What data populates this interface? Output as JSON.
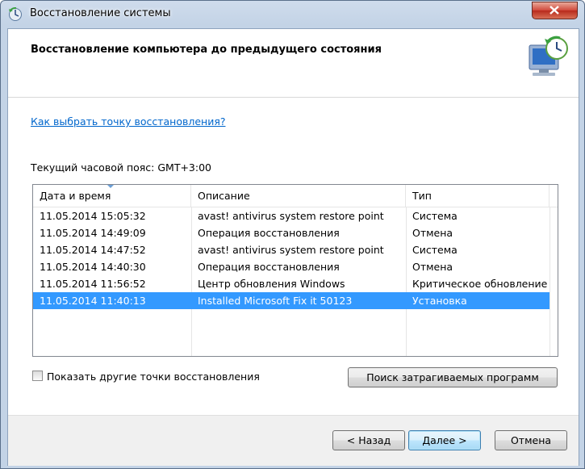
{
  "window": {
    "title": "Восстановление системы"
  },
  "header": {
    "title": "Восстановление компьютера до предыдущего состояния"
  },
  "help_link": "Как выбрать точку восстановления?",
  "timezone_label": "Текущий часовой пояс: GMT+3:00",
  "table": {
    "columns": [
      "Дата и время",
      "Описание",
      "Тип"
    ],
    "sorted_column": "Дата и время",
    "rows": [
      {
        "date": "11.05.2014 15:05:32",
        "description": "avast! antivirus system restore point",
        "type": "Система",
        "selected": false
      },
      {
        "date": "11.05.2014 14:49:09",
        "description": "Операция восстановления",
        "type": "Отмена",
        "selected": false
      },
      {
        "date": "11.05.2014 14:47:52",
        "description": "avast! antivirus system restore point",
        "type": "Система",
        "selected": false
      },
      {
        "date": "11.05.2014 14:40:30",
        "description": "Операция восстановления",
        "type": "Отмена",
        "selected": false
      },
      {
        "date": "11.05.2014 11:56:52",
        "description": "Центр обновления Windows",
        "type": "Критическое обновление",
        "selected": false
      },
      {
        "date": "11.05.2014 11:40:13",
        "description": "Installed Microsoft Fix it 50123",
        "type": "Установка",
        "selected": true
      }
    ]
  },
  "show_more_checkbox": {
    "label": "Показать другие точки восстановления",
    "checked": false
  },
  "buttons": {
    "scan": "Поиск затрагиваемых программ",
    "back": "< Назад",
    "next": "Далее >",
    "cancel": "Отмена"
  },
  "colors": {
    "selection": "#3399ff",
    "link": "#0066cc"
  }
}
